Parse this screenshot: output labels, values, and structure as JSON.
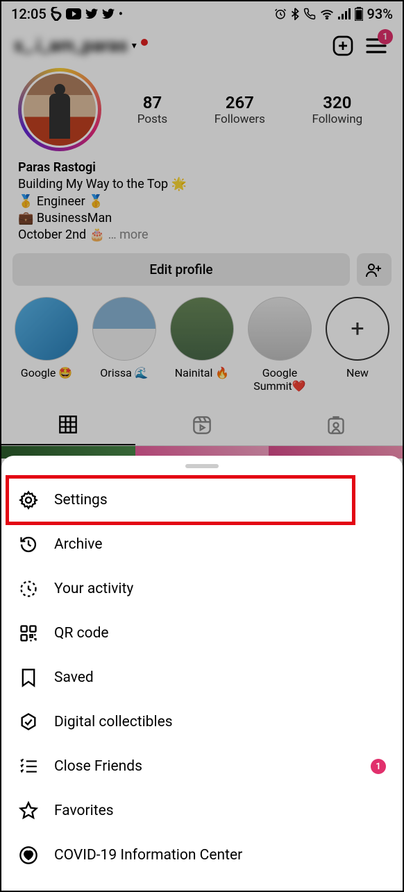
{
  "statusbar": {
    "time": "12:05",
    "battery": "93%"
  },
  "header": {
    "username": "s_.i_am_paras",
    "notif_badge": "1"
  },
  "stats": {
    "posts_num": "87",
    "posts_lbl": "Posts",
    "followers_num": "267",
    "followers_lbl": "Followers",
    "following_num": "320",
    "following_lbl": "Following"
  },
  "bio": {
    "name": "Paras Rastogi",
    "line1": "Building My Way to the Top 🌟",
    "line2": "🥇 Engineer 🥇",
    "line3": "💼  BusinessMan",
    "line4": "October 2nd 🎂",
    "more": "… more"
  },
  "edit_label": "Edit profile",
  "highlights": [
    {
      "label": "Google 🤩"
    },
    {
      "label": "Orissa 🌊"
    },
    {
      "label": "Nainital 🔥"
    },
    {
      "label": "Google Summit❤️"
    },
    {
      "label": "New"
    }
  ],
  "menu": {
    "settings": "Settings",
    "archive": "Archive",
    "activity": "Your activity",
    "qr": "QR code",
    "saved": "Saved",
    "collectibles": "Digital collectibles",
    "close_friends": "Close Friends",
    "close_friends_badge": "1",
    "favorites": "Favorites",
    "covid": "COVID-19 Information Center"
  }
}
